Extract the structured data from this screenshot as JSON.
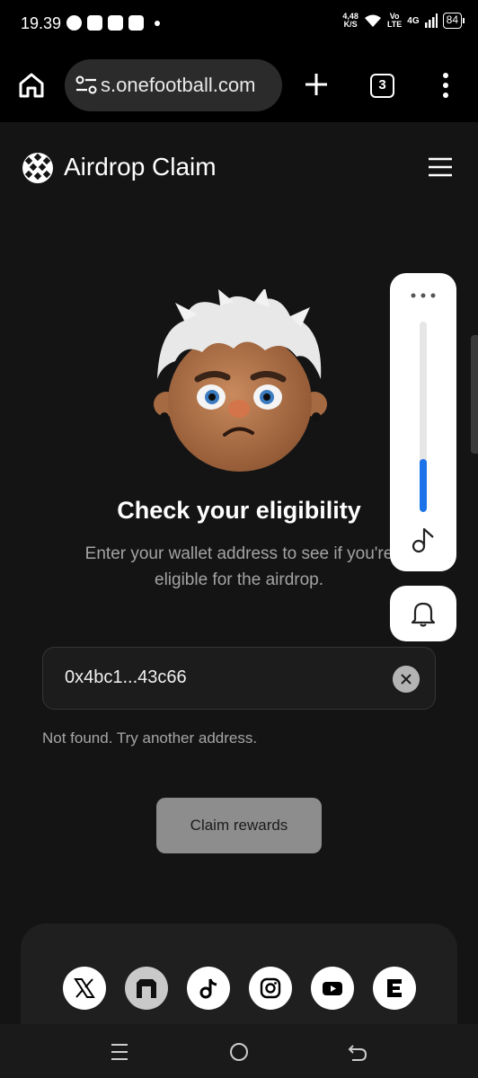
{
  "status_bar": {
    "time": "19.39",
    "speed_value": "4,48",
    "speed_unit": "K/S",
    "network_volte_top": "Vo",
    "network_volte_bottom": "LTE",
    "network_type": "4G",
    "battery": "84"
  },
  "browser": {
    "url": "s.onefootball.com",
    "tab_count": "3"
  },
  "site": {
    "title": "Airdrop Claim"
  },
  "main": {
    "headline": "Check your eligibility",
    "subtext": "Enter your wallet address to see if you're eligible for the airdrop."
  },
  "wallet_field": {
    "value": "0x4bc1...43c66"
  },
  "error_message": "Not found. Try another address.",
  "claim_button": {
    "label": "Claim rewards"
  },
  "volume_panel": {
    "level": 0.28,
    "accent_color": "#1a73e8"
  },
  "social_links": [
    {
      "icon": "x-icon"
    },
    {
      "icon": "gate-icon"
    },
    {
      "icon": "tiktok-icon"
    },
    {
      "icon": "instagram-icon"
    },
    {
      "icon": "youtube-icon"
    },
    {
      "icon": "e-logo-icon"
    }
  ],
  "colors": {
    "background": "#141414",
    "button_disabled": "#8d8d8d",
    "muted_text": "#a3a3a3"
  }
}
